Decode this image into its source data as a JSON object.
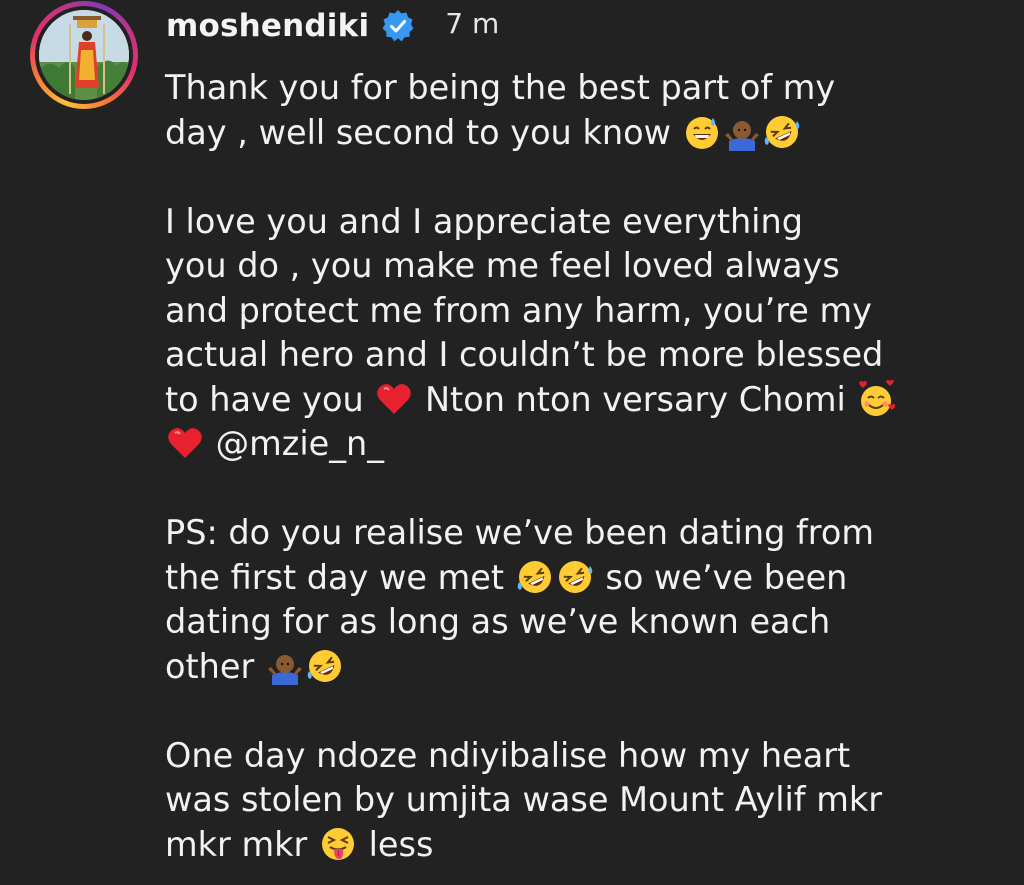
{
  "post": {
    "username": "moshendiki",
    "time": "7 m",
    "verified_color": "#3897f0"
  },
  "caption": {
    "p1": {
      "line1": "Thank you for being the best part of my",
      "line2_text": "day , well second to you know"
    },
    "p2": {
      "line1": "I love you and I appreciate everything",
      "line2": "you do , you make me feel loved always",
      "line3": "and protect me from any harm, you’re my",
      "line4": "actual hero and I couldn’t be more blessed",
      "line5_a": "to have you",
      "line5_b": "Nton nton versary Chomi",
      "mention": "@mzie_n_"
    },
    "p3": {
      "line1": "PS: do you realise we’ve been dating from",
      "line2_a": "the first day we met",
      "line2_b": "so we’ve been",
      "line3": "dating for as long as we’ve known each",
      "line4_a": "other"
    },
    "p4": {
      "line1": "One day ndoze ndiyibalise how my heart",
      "line2": "was stolen by umjita wase Mount Aylif mkr",
      "line3_a": "mkr mkr",
      "line3_b": "less"
    }
  },
  "emojis": [
    "grinning-sweat",
    "person-shrugging",
    "rolling-laughing",
    "red-heart",
    "smiling-hearts",
    "squinting-tongue"
  ]
}
